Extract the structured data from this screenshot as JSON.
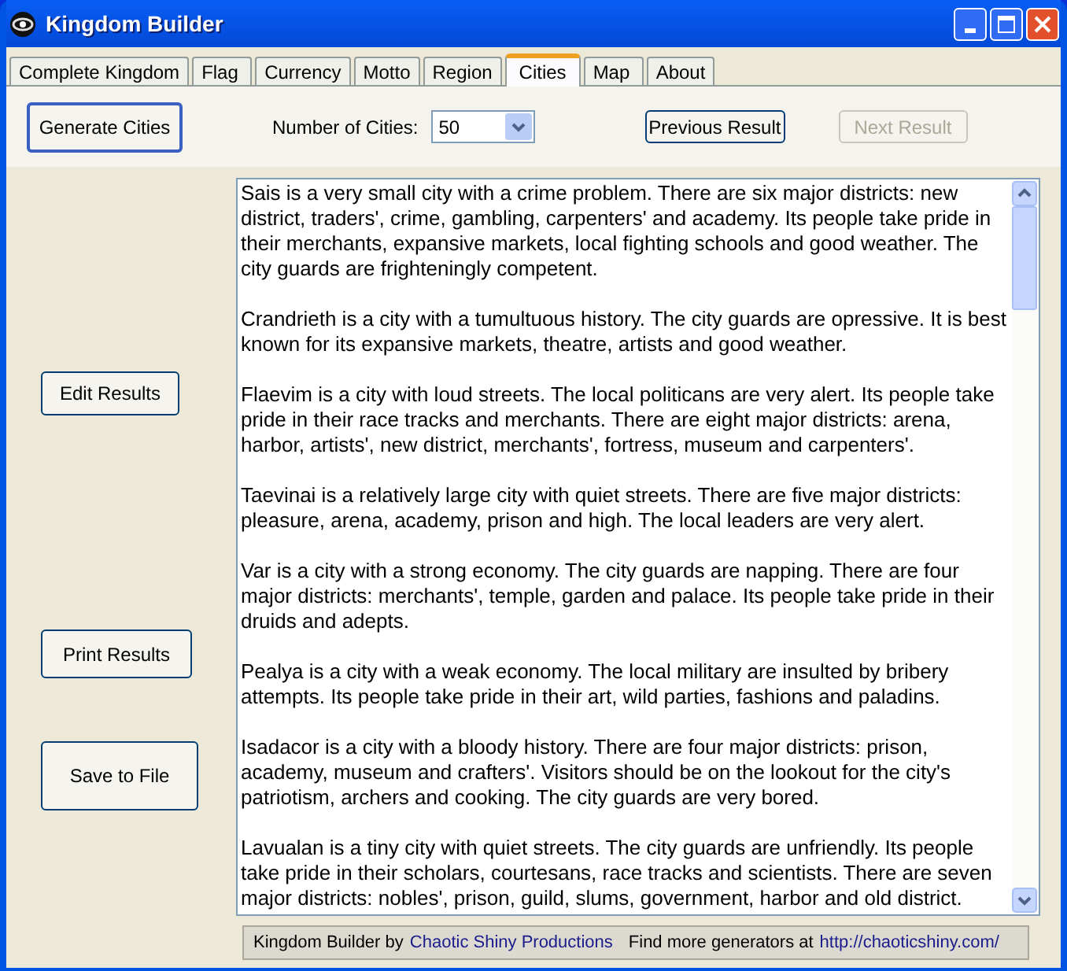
{
  "window": {
    "title": "Kingdom Builder"
  },
  "tabs": [
    {
      "label": "Complete Kingdom",
      "selected": false
    },
    {
      "label": "Flag",
      "selected": false
    },
    {
      "label": "Currency",
      "selected": false
    },
    {
      "label": "Motto",
      "selected": false
    },
    {
      "label": "Region",
      "selected": false
    },
    {
      "label": "Cities",
      "selected": true
    },
    {
      "label": "Map",
      "selected": false
    },
    {
      "label": "About",
      "selected": false
    }
  ],
  "toolbar": {
    "generate_button": "Generate Cities",
    "count_label": "Number of Cities:",
    "count_value": "50",
    "previous_button": {
      "label": "Previous Result",
      "disabled": false
    },
    "next_button": {
      "label": "Next Result",
      "disabled": true
    }
  },
  "side_buttons": [
    "Edit Results",
    "Print Results",
    "Save to File"
  ],
  "results": [
    "Sais is a very small city with a crime problem. There are six major districts: new district, traders', crime, gambling, carpenters' and academy. Its people take pride in their merchants, expansive markets, local fighting schools and good weather. The city guards are frighteningly competent.",
    "Crandrieth is a city with a tumultuous history. The city guards are opressive. It is best known for its expansive markets, theatre, artists and good weather.",
    "Flaevim is a city with loud streets. The local politicans are very alert. Its people take pride in their race tracks and merchants. There are eight major districts: arena, harbor, artists', new district, merchants', fortress, museum and carpenters'.",
    "Taevinai is a relatively large city with quiet streets. There are five major districts: pleasure, arena, academy, prison and high. The local leaders are very alert.",
    "Var is a city with a strong economy. The city guards are napping. There are four major districts: merchants', temple, garden and palace. Its people take pride in their druids and adepts.",
    "Pealya is a city with a weak economy. The local military are insulted by bribery attempts. Its people take pride in their art, wild parties, fashions and paladins.",
    "Isadacor is a city with a bloody history. There are four major districts: prison, academy, museum and crafters'. Visitors should be on the lookout for the city's patriotism, archers and cooking. The city guards are very bored.",
    "Lavualan is a tiny city with quiet streets. The city guards are unfriendly. Its people take pride in their scholars, courtesans, race tracks and scientists. There are seven major districts: nobles', prison, guild, slums, government, harbor and old district."
  ],
  "footer": {
    "credit_label": "Kingdom Builder by",
    "credit_link": "Chaotic Shiny Productions",
    "more_label": "Find more generators at",
    "more_link": "http://chaoticshiny.com/"
  }
}
